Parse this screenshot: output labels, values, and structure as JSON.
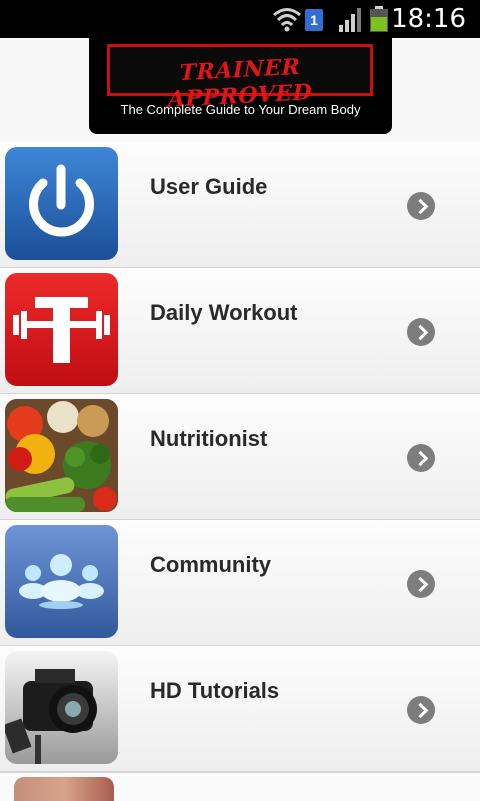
{
  "status": {
    "time": "18:16",
    "notification_count": "1"
  },
  "banner": {
    "title": "TRAINER APPROVED",
    "tagline": "The Complete Guide to Your Dream Body"
  },
  "menu": [
    {
      "label": "User Guide",
      "icon": "power-icon"
    },
    {
      "label": "Daily Workout",
      "icon": "dumbbell-icon"
    },
    {
      "label": "Nutritionist",
      "icon": "vegetables-image"
    },
    {
      "label": "Community",
      "icon": "people-icon"
    },
    {
      "label": "HD Tutorials",
      "icon": "camera-image"
    }
  ],
  "colors": {
    "accent_red": "#e01515",
    "user_guide_blue": "#1f5da8",
    "workout_red": "#d9151b",
    "community_blue": "#4a76b8",
    "chevron": "#7d7d7d"
  }
}
